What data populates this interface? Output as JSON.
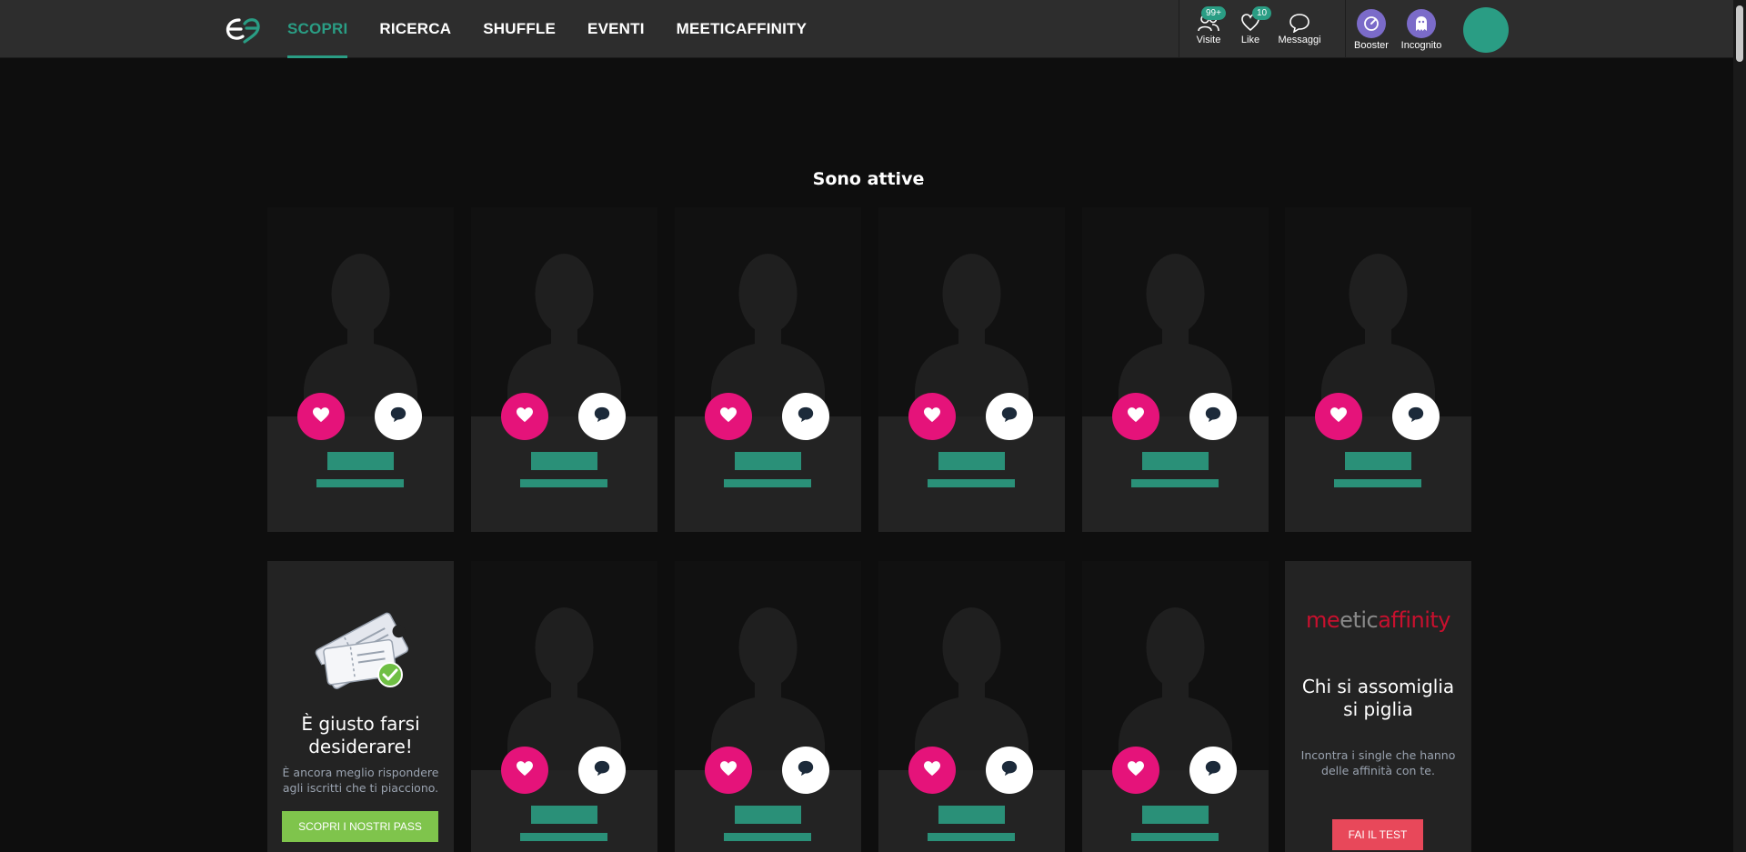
{
  "nav": {
    "items": [
      {
        "label": "SCOPRI",
        "active": true
      },
      {
        "label": "RICERCA",
        "active": false
      },
      {
        "label": "SHUFFLE",
        "active": false
      },
      {
        "label": "EVENTI",
        "active": false
      },
      {
        "label": "MEETICAFFINITY",
        "active": false
      }
    ]
  },
  "tools": {
    "visite": {
      "label": "Visite",
      "badge": "99+",
      "icon": "visitors-icon"
    },
    "like": {
      "label": "Like",
      "badge": "10",
      "icon": "heart-outline-icon"
    },
    "messaggi": {
      "label": "Messaggi",
      "icon": "speech-bubble-icon"
    },
    "booster": {
      "label": "Booster",
      "icon": "booster-icon"
    },
    "incognito": {
      "label": "Incognito",
      "icon": "ghost-icon"
    }
  },
  "section": {
    "title": "Sono attive"
  },
  "promo_pass": {
    "title": "È giusto farsi desiderare!",
    "subtitle": "È ancora meglio rispondere agli iscritti che ti piacciono.",
    "button": "SCOPRI I NOSTRI PASS",
    "icon": "ticket-check-icon"
  },
  "promo_affinity": {
    "logo_a": "me",
    "logo_b": "etic",
    "logo_c": "affinity",
    "title": "Chi si assomiglia si piglia",
    "subtitle": "Incontra i single che hanno delle affinità con te.",
    "button": "FAI IL TEST"
  },
  "colors": {
    "accent": "#2a9d84",
    "like": "#e5137a",
    "pass_button": "#7fc44c",
    "test_button": "#e8485a",
    "booster": "#7b6bc9"
  }
}
